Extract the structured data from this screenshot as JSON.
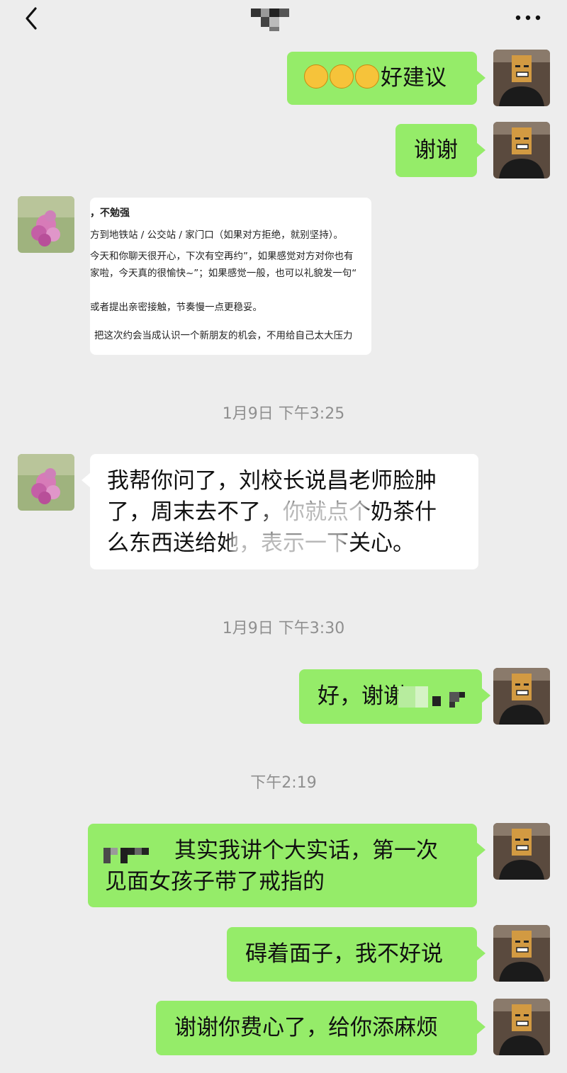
{
  "header": {
    "back_icon": "chevron-left-icon",
    "more_icon": "more-dots-icon"
  },
  "messages": [
    {
      "id": "m1",
      "from": "me",
      "emojis": "😁😁😁",
      "text": "好建议"
    },
    {
      "id": "m2",
      "from": "me",
      "text": "谢谢"
    },
    {
      "id": "m3",
      "from": "other",
      "type": "screenshot",
      "lines": [
        "，不勉强",
        "方到地铁站 / 公交站 / 家门口（如果对方拒绝，就别坚持）。",
        "今天和你聊天很开心，下次有空再约”，如果感觉对方对你也有",
        "家啦，今天真的很愉快~”；如果感觉一般，也可以礼貌发一句“",
        "或者提出亲密接触，节奏慢一点更稳妥。",
        "把这次约会当成认识一个新朋友的机会，不用给自己太大压力"
      ]
    },
    {
      "id": "t1",
      "type": "time",
      "text": "1月9日 下午3:25"
    },
    {
      "id": "m4",
      "from": "other",
      "lines": [
        "我帮你问了，刘校长说昌老师脸肿",
        "了，周末去不了，你就点个奶茶什",
        "么东西送给她，表示一下关心。"
      ]
    },
    {
      "id": "t2",
      "type": "time",
      "text": "1月9日 下午3:30"
    },
    {
      "id": "m5",
      "from": "me",
      "text": "好，谢谢"
    },
    {
      "id": "t3",
      "type": "time",
      "text": "下午2:19"
    },
    {
      "id": "m6",
      "from": "me",
      "lines": [
        "其实我讲个大实话，第一次",
        "见面女孩子带了戒指的"
      ]
    },
    {
      "id": "m7",
      "from": "me",
      "text": "碍着面子，我不好说"
    },
    {
      "id": "m8",
      "from": "me",
      "text": "谢谢你费心了，给你添麻烦"
    }
  ],
  "colors": {
    "me_bubble": "#95ec69",
    "other_bubble": "#ffffff",
    "background": "#ededed",
    "time_text": "#8f8f8f"
  }
}
